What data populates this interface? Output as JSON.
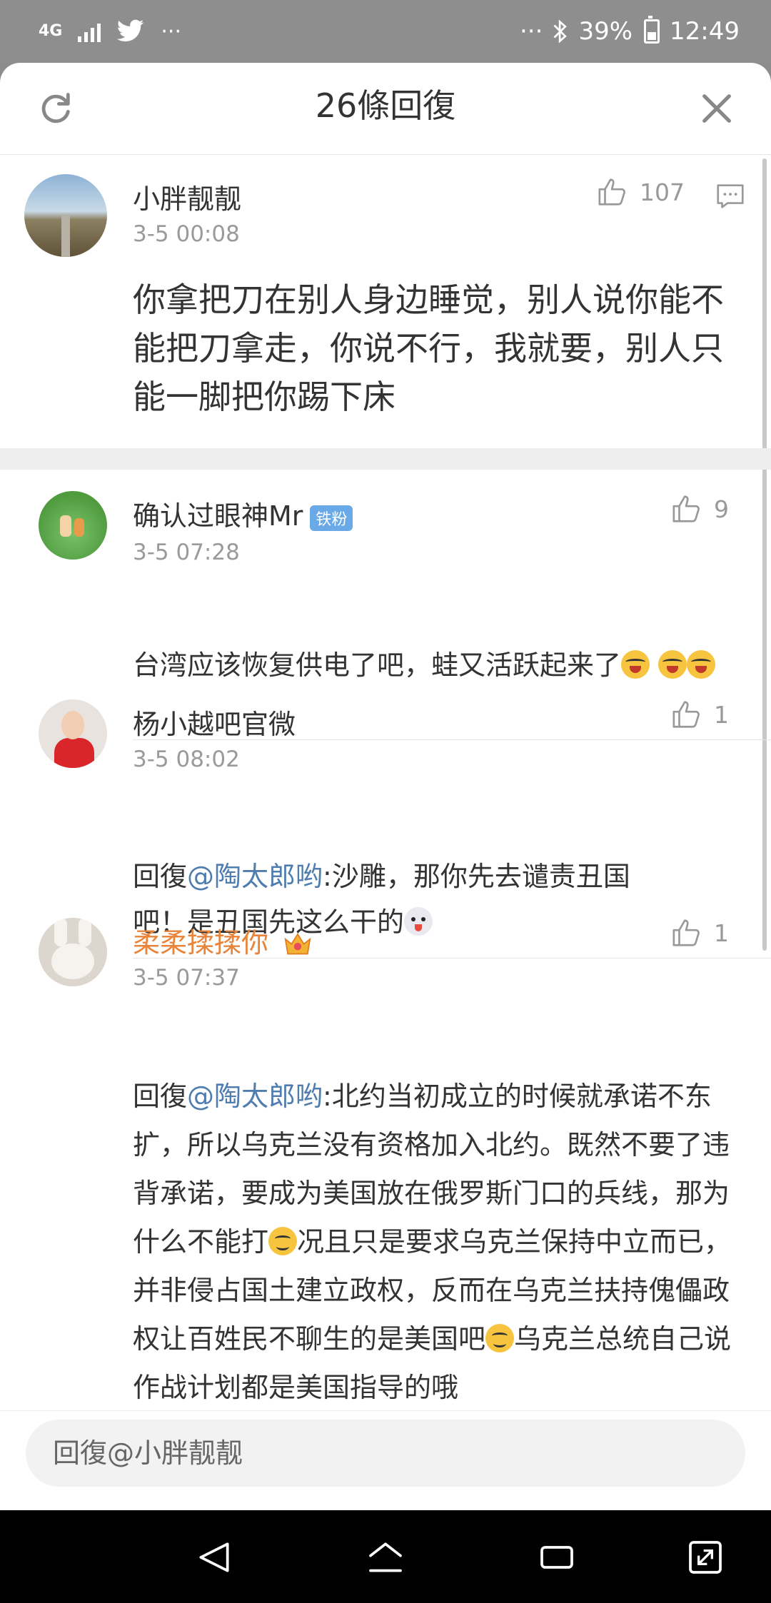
{
  "status_bar": {
    "network": "4G",
    "dots_left": "···",
    "dots_right": "···",
    "battery": "39%",
    "time": "12:49"
  },
  "header": {
    "title": "26條回復"
  },
  "main_comment": {
    "user": "小胖靓靓",
    "time": "3-5 00:08",
    "likes": "107",
    "text": "你拿把刀在别人身边睡觉，别人说你能不能把刀拿走，你说不行，我就要，别人只能一脚把你踢下床"
  },
  "replies": [
    {
      "user": "确认过眼神Mr",
      "badge": "铁粉",
      "time": "3-5 07:28",
      "likes": "9",
      "text": "台湾应该恢复供电了吧，蛙又活跃起来了"
    },
    {
      "user": "杨小越吧官微",
      "time": "3-5 08:02",
      "likes": "1",
      "reply_prefix": "回復",
      "mention": "@陶太郎哟",
      "text": ":沙雕，那你先去谴责丑国吧！是丑国先这么干的"
    },
    {
      "user": "柔柔揉揉你",
      "user_color": "#e8843a",
      "time": "3-5 07:37",
      "likes": "1",
      "reply_prefix": "回復",
      "mention": "@陶太郎哟",
      "text_a": ":北约当初成立的时候就承诺不东扩，所以乌克兰没有资格加入北约。既然不要了违背承诺，要成为美国放在俄罗斯门口的兵线，那为什么不能打",
      "text_b": "况且只是要求乌克兰保持中立而已，并非侵占国土建立政权，反而在乌克兰扶持傀儡政权让百姓民不聊生的是美国吧",
      "text_c": "乌克兰总统自己说作战计划都是美国指导的哦"
    }
  ],
  "reply_box": {
    "placeholder": "回復@小胖靓靓"
  },
  "icons": [
    "refresh-icon",
    "close-icon",
    "thumb-up-icon",
    "comment-icon",
    "back-icon",
    "home-icon",
    "recents-icon",
    "expand-icon"
  ]
}
